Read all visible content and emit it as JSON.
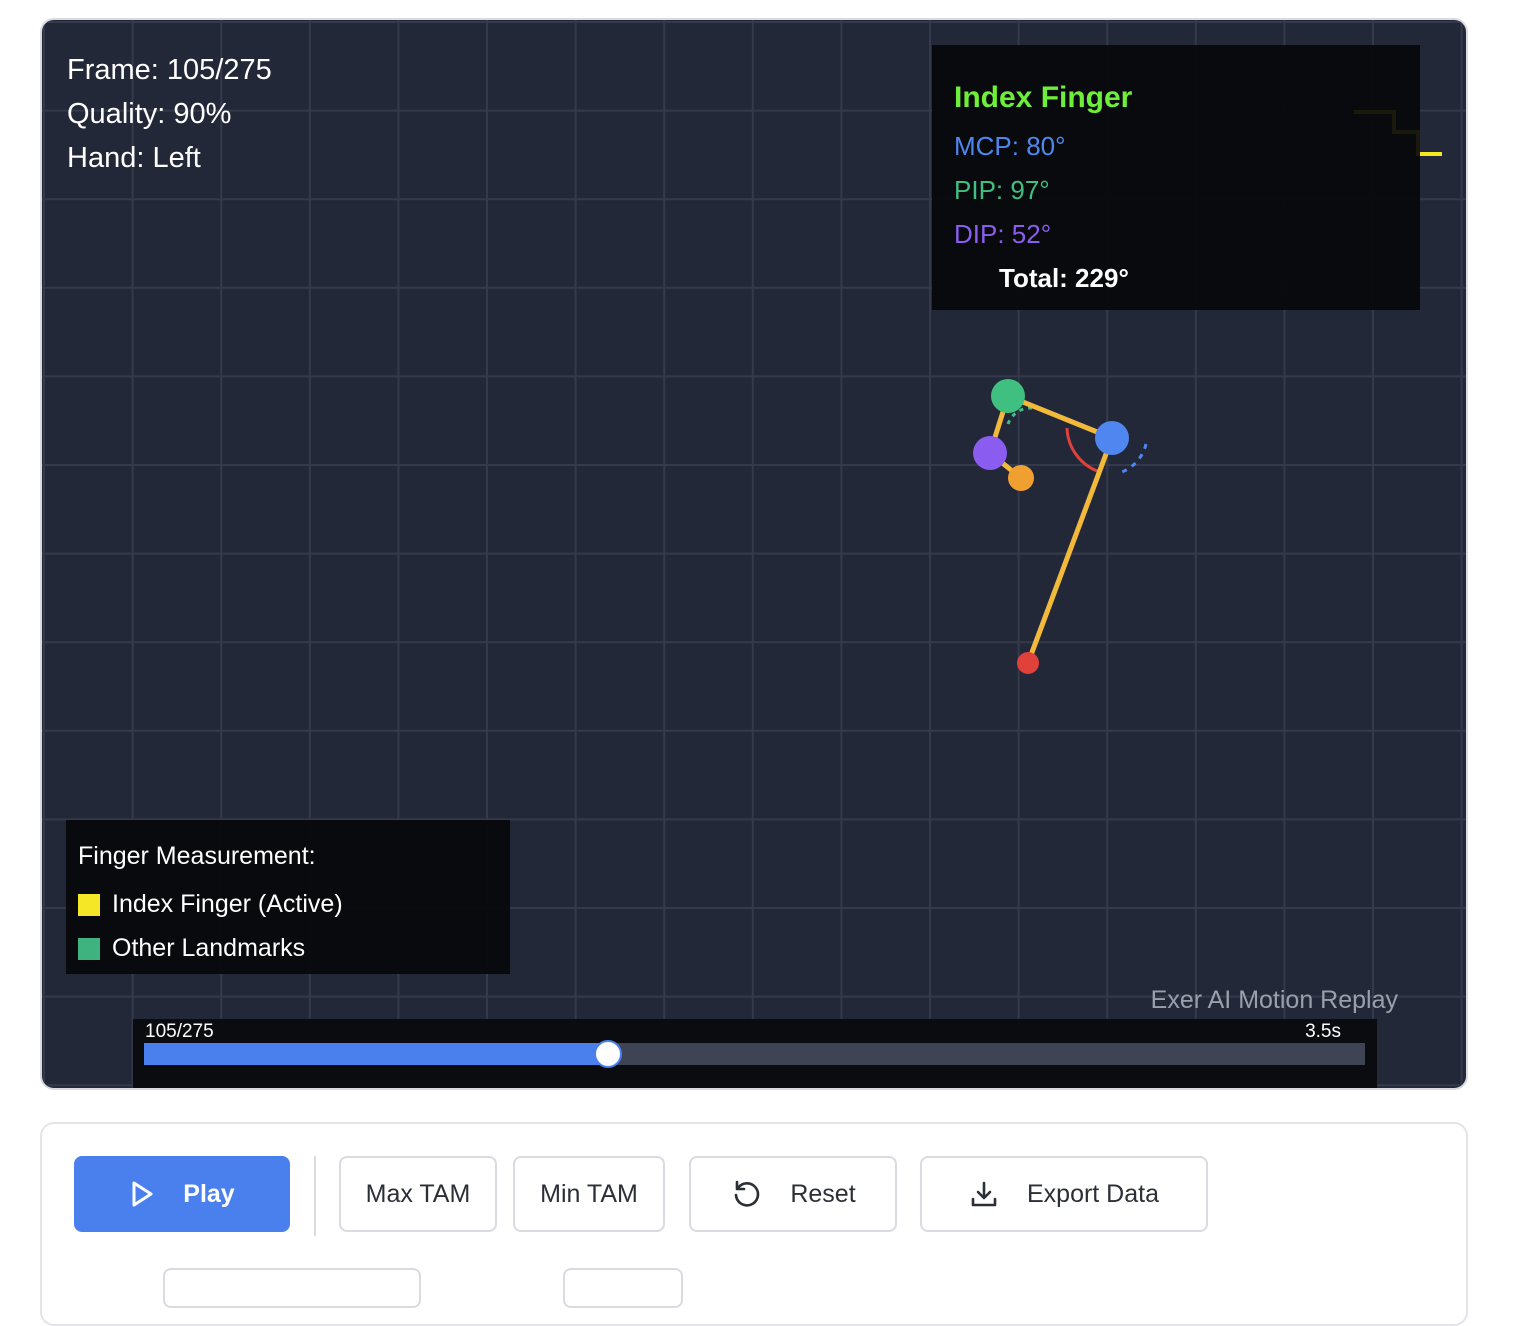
{
  "hud": {
    "frame": "Frame: 105/275",
    "quality": "Quality: 90%",
    "hand": "Hand: Left"
  },
  "angles_panel": {
    "title": "Index Finger",
    "mcp": "MCP: 80°",
    "pip": "PIP: 97°",
    "dip": "DIP: 52°",
    "total": "Total: 229°"
  },
  "legend": {
    "title": "Finger Measurement:",
    "items": [
      {
        "label": "Index Finger (Active)",
        "color": "#f5e626"
      },
      {
        "label": "Other Landmarks",
        "color": "#3fb37f"
      }
    ]
  },
  "watermark": "Exer AI Motion Replay",
  "timeline": {
    "frame_label": "105/275",
    "time_label": "3.5s",
    "progress": 0.38
  },
  "controls": {
    "play": "Play",
    "max_tam": "Max TAM",
    "min_tam": "Min TAM",
    "reset": "Reset",
    "export": "Export Data"
  },
  "colors": {
    "accent": "#4a80ee",
    "finger_line": "#f2b93b",
    "mcp": "#4f86f0",
    "pip": "#3fbf80",
    "dip": "#8a5cf0",
    "tip": "#f0a030",
    "wrist": "#e0413a",
    "angle_arc": "#e0413a"
  },
  "icons": {
    "play": "play-icon",
    "reset": "reset-icon",
    "export": "download-icon",
    "status": "stepped-line-icon"
  }
}
